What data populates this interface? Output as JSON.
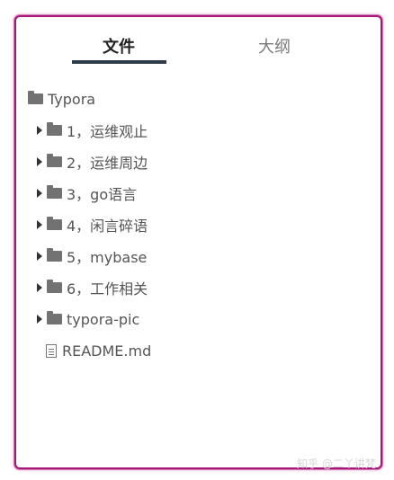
{
  "tabs": {
    "files": "文件",
    "outline": "大纲"
  },
  "tree": {
    "root": "Typora",
    "items": [
      "1，运维观止",
      "2，运维周边",
      "3，go语言",
      "4，闲言碎语",
      "5，mybase",
      "6，工作相关",
      "typora-pic"
    ],
    "file": "README.md"
  },
  "watermark": "知乎 @二丫讲梵",
  "colors": {
    "frame": "#a8177a",
    "active_tab_underline": "#2f3a48",
    "folder": "#727272"
  }
}
